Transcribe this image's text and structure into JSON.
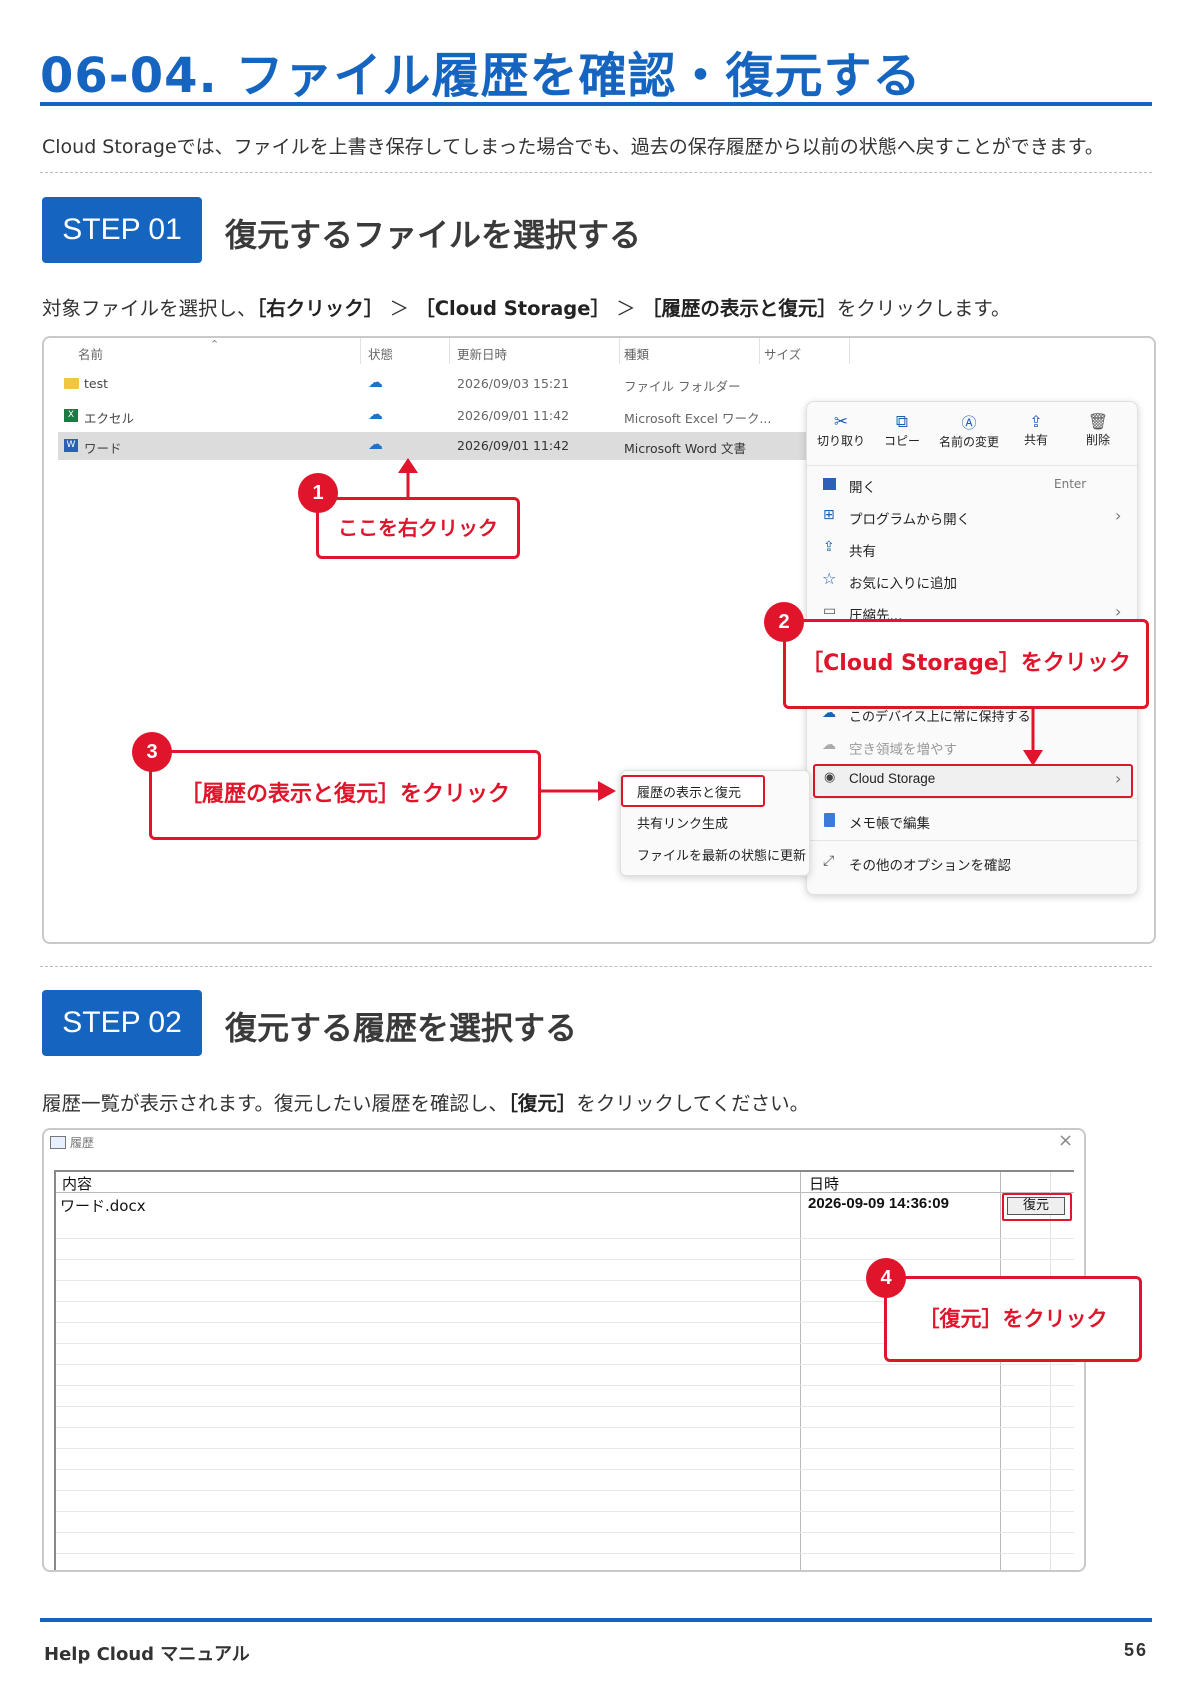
{
  "title": "06-04. ファイル履歴を確認・復元する",
  "intro": "Cloud Storageでは、ファイルを上書き保存してしまった場合でも、過去の保存履歴から以前の状態へ戻すことができます。",
  "step1": {
    "badge": "STEP 01",
    "title": "復元するファイルを選択する",
    "desc_pre": "対象ファイルを選択し、",
    "desc_b1": "［右クリック］",
    "desc_gt1": "＞",
    "desc_b2": "［Cloud Storage］",
    "desc_gt2": "＞",
    "desc_b3": "［履歴の表示と復元］",
    "desc_post": "をクリックします。"
  },
  "explorer": {
    "headers": {
      "name": "名前",
      "status": "状態",
      "date": "更新日時",
      "type": "種類",
      "size": "サイズ"
    },
    "rows": [
      {
        "name": "test",
        "date": "2026/09/03 15:21",
        "type": "ファイル フォルダー"
      },
      {
        "name": "エクセル",
        "date": "2026/09/01 11:42",
        "type": "Microsoft Excel ワーク..."
      },
      {
        "name": "ワード",
        "date": "2026/09/01 11:42",
        "type": "Microsoft Word 文書"
      }
    ]
  },
  "context_menu": {
    "toolbar": {
      "cut": "切り取り",
      "copy": "コピー",
      "rename": "名前の変更",
      "share": "共有",
      "delete": "削除"
    },
    "open": "開く",
    "open_shortcut": "Enter",
    "open_with": "プログラムから開く",
    "share": "共有",
    "favorite": "お気に入りに追加",
    "compress": "圧縮先...",
    "keep_on_device": "このデバイス上に常に保持する",
    "free_space": "空き領域を増やす",
    "cloud_storage": "Cloud Storage",
    "notepad": "メモ帳で編集",
    "more_options": "その他のオプションを確認"
  },
  "submenu": {
    "history": "履歴の表示と復元",
    "share_link": "共有リンク生成",
    "refresh": "ファイルを最新の状態に更新"
  },
  "callouts": {
    "c1_num": "1",
    "c1_text": "ここを右クリック",
    "c2_num": "2",
    "c2_text": "［Cloud Storage］をクリック",
    "c3_num": "3",
    "c3_text": "［履歴の表示と復元］をクリック",
    "c4_num": "4",
    "c4_text": "［復元］をクリック"
  },
  "step2": {
    "badge": "STEP 02",
    "title": "復元する履歴を選択する",
    "desc_pre": "履歴一覧が表示されます。復元したい履歴を確認し、",
    "desc_b": "［復元］",
    "desc_post": "をクリックしてください。"
  },
  "history_window": {
    "title": "履歴",
    "close": "×",
    "col_content": "内容",
    "col_datetime": "日時",
    "file": "ワード.docx",
    "datetime": "2026-09-09 14:36:09",
    "restore_button": "復元"
  },
  "footer": {
    "left": "Help Cloud マニュアル",
    "page": "56"
  },
  "colors": {
    "brand": "#1565c0",
    "accent": "#e0142a"
  }
}
